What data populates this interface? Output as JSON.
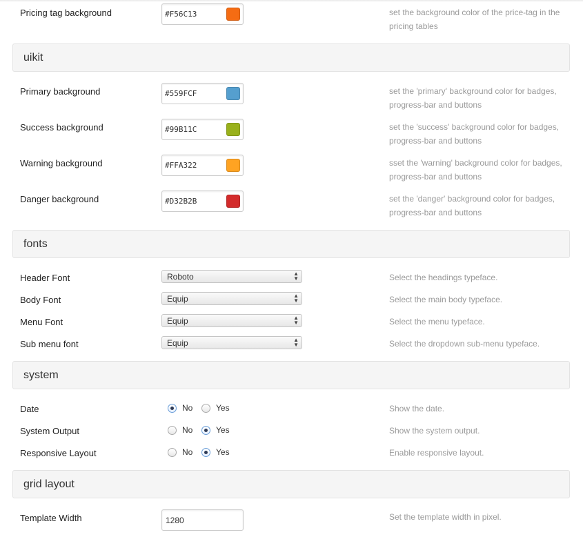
{
  "pricing": {
    "label": "Pricing tag background",
    "value": "#F56C13",
    "color": "#F56C13",
    "desc": "set the background color of the price-tag in the pricing tables"
  },
  "uikit": {
    "title": "uikit",
    "items": [
      {
        "label": "Primary background",
        "value": "#559FCF",
        "color": "#559FCF",
        "desc": "set the 'primary' background color for badges, progress-bar and buttons"
      },
      {
        "label": "Success background",
        "value": "#99B11C",
        "color": "#99B11C",
        "desc": "set the 'success' background color for badges, progress-bar and buttons"
      },
      {
        "label": "Warning background",
        "value": "#FFA322",
        "color": "#FFA322",
        "desc": "sset the 'warning' background color for badges, progress-bar and buttons"
      },
      {
        "label": "Danger background",
        "value": "#D32B2B",
        "color": "#D32B2B",
        "desc": "set the 'danger' background color for badges, progress-bar and buttons"
      }
    ]
  },
  "fonts": {
    "title": "fonts",
    "items": [
      {
        "label": "Header Font",
        "value": "Roboto",
        "desc": "Select the headings typeface."
      },
      {
        "label": "Body Font",
        "value": "Equip",
        "desc": "Select the main body typeface."
      },
      {
        "label": "Menu Font",
        "value": "Equip",
        "desc": "Select the menu typeface."
      },
      {
        "label": "Sub menu font",
        "value": "Equip",
        "desc": "Select the dropdown sub-menu typeface."
      }
    ]
  },
  "system": {
    "title": "system",
    "no_label": "No",
    "yes_label": "Yes",
    "items": [
      {
        "label": "Date",
        "selected": "No",
        "desc": "Show the date."
      },
      {
        "label": "System Output",
        "selected": "Yes",
        "desc": "Show the system output."
      },
      {
        "label": "Responsive Layout",
        "selected": "Yes",
        "desc": "Enable responsive layout."
      }
    ]
  },
  "grid": {
    "title": "grid layout",
    "items": [
      {
        "label": "Template Width",
        "value": "1280",
        "desc": "Set the template width in pixel."
      }
    ]
  }
}
